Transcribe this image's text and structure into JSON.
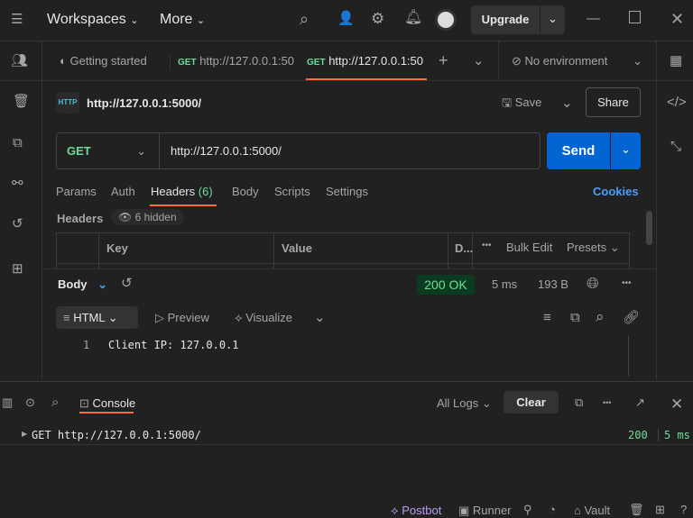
{
  "topbar": {
    "workspaces": "Workspaces",
    "more": "More",
    "upgrade": "Upgrade"
  },
  "tabs": [
    {
      "label": "Getting started"
    },
    {
      "method": "GET",
      "label": "http://127.0.0.1:50"
    },
    {
      "method": "GET",
      "label": "http://127.0.0.1:50"
    }
  ],
  "environment": "No environment",
  "request": {
    "title": "http://127.0.0.1:5000/",
    "save": "Save",
    "share": "Share",
    "method": "GET",
    "url": "http://127.0.0.1:5000/",
    "send": "Send"
  },
  "req_tabs": {
    "params": "Params",
    "auth": "Auth",
    "headers": "Headers",
    "headers_count": "(6)",
    "body": "Body",
    "scripts": "Scripts",
    "settings": "Settings",
    "cookies": "Cookies"
  },
  "headers": {
    "label": "Headers",
    "hidden": "6 hidden",
    "cols": [
      "Key",
      "Value",
      "D..."
    ],
    "bulk_edit": "Bulk Edit",
    "presets": "Presets"
  },
  "response": {
    "body": "Body",
    "status": "200 OK",
    "time": "5 ms",
    "size": "193 B",
    "format": "HTML",
    "preview": "Preview",
    "visualize": "Visualize",
    "lines": [
      {
        "n": "1",
        "text": "Client IP: 127.0.0.1"
      }
    ]
  },
  "console": {
    "tab": "Console",
    "filter": "All Logs",
    "clear": "Clear",
    "logs": [
      {
        "text": "GET http://127.0.0.1:5000/",
        "status": "200",
        "time": "5 ms"
      }
    ]
  },
  "footer": {
    "postbot": "Postbot",
    "runner": "Runner",
    "vault": "Vault"
  }
}
